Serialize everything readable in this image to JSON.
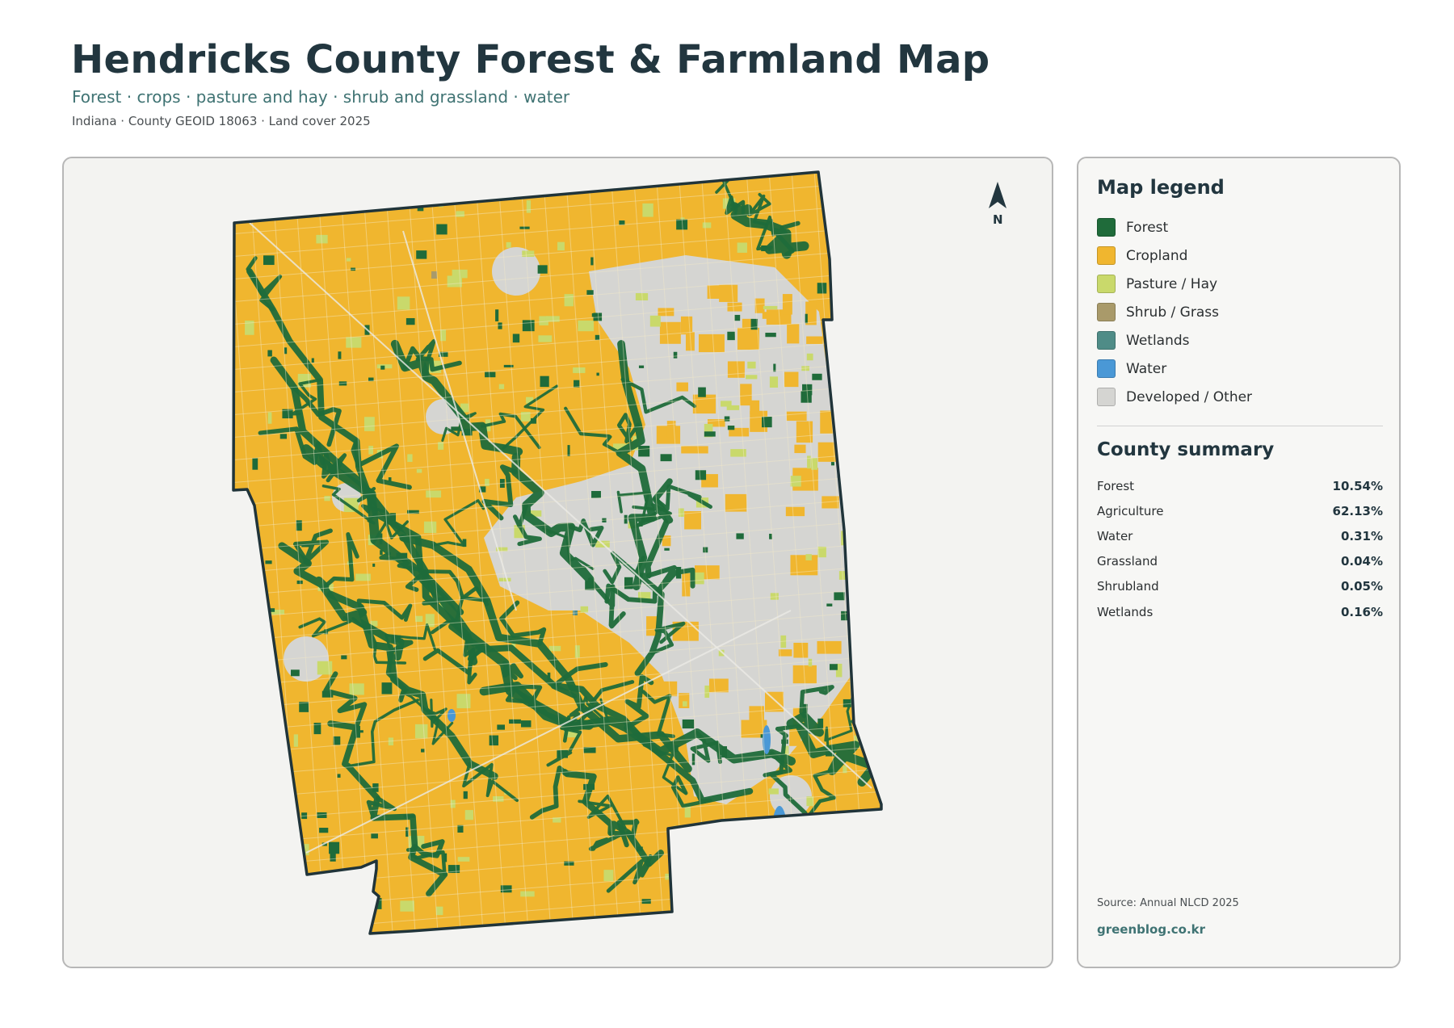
{
  "header": {
    "title": "Hendricks County Forest & Farmland Map",
    "subtitle": "Forest · crops · pasture and hay · shrub and grassland · water",
    "meta": "Indiana · County GEOID 18063 · Land cover 2025"
  },
  "map": {
    "north_label": "N",
    "north_arrow_icon": "north-arrow-icon",
    "colors": {
      "forest": "#1f6b3a",
      "cropland": "#f0b62f",
      "pasture": "#c9d96b",
      "shrub": "#a99a6a",
      "wetlands": "#4f8c87",
      "water": "#4a98d6",
      "developed": "#d5d5d2",
      "boundary": "#20343a"
    }
  },
  "legend": {
    "title": "Map legend",
    "items": [
      {
        "label": "Forest",
        "color": "#1f6b3a"
      },
      {
        "label": "Cropland",
        "color": "#f0b62f"
      },
      {
        "label": "Pasture / Hay",
        "color": "#c9d96b"
      },
      {
        "label": "Shrub / Grass",
        "color": "#a99a6a"
      },
      {
        "label": "Wetlands",
        "color": "#4f8c87"
      },
      {
        "label": "Water",
        "color": "#4a98d6"
      },
      {
        "label": "Developed / Other",
        "color": "#d5d5d2"
      }
    ]
  },
  "summary": {
    "title": "County summary",
    "rows": [
      {
        "name": "Forest",
        "value": "10.54%"
      },
      {
        "name": "Agriculture",
        "value": "62.13%"
      },
      {
        "name": "Water",
        "value": "0.31%"
      },
      {
        "name": "Grassland",
        "value": "0.04%"
      },
      {
        "name": "Shrubland",
        "value": "0.05%"
      },
      {
        "name": "Wetlands",
        "value": "0.16%"
      }
    ]
  },
  "footer": {
    "source": "Source: Annual NLCD 2025",
    "brand": "greenblog.co.kr"
  }
}
